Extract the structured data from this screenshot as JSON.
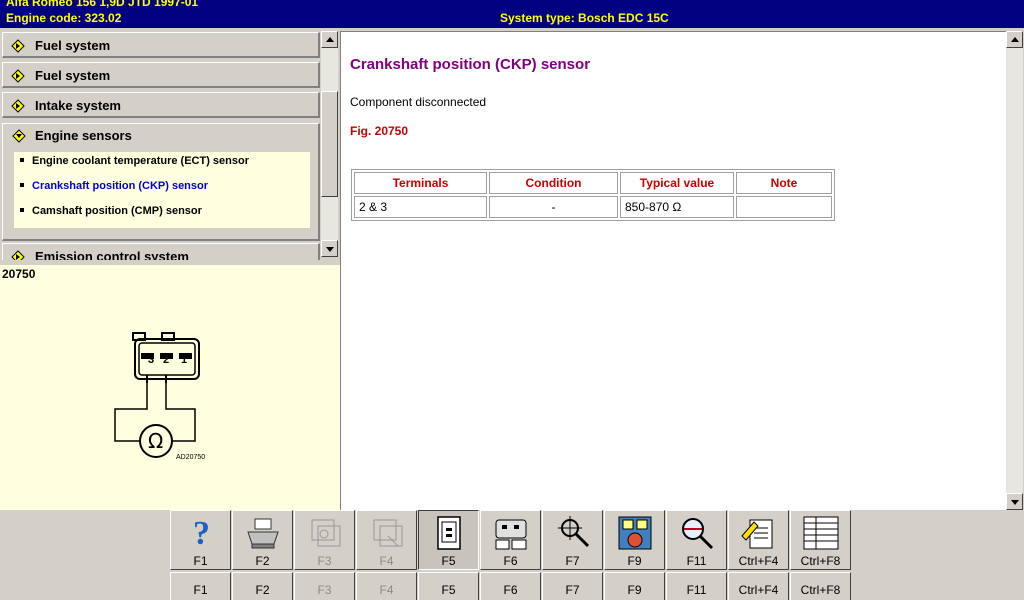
{
  "header": {
    "vehicle": "Alfa Romeo   156   1,9D JTD 1997-01",
    "engine_code": "Engine code: 323.02",
    "system_type": "System type: Bosch EDC 15C"
  },
  "nav": {
    "categories": [
      {
        "label": "Fuel system"
      },
      {
        "label": "Fuel system"
      },
      {
        "label": "Intake system"
      },
      {
        "label": "Engine sensors"
      },
      {
        "label": "Emission control system"
      }
    ],
    "sub_items": [
      {
        "label": "Engine coolant temperature (ECT) sensor"
      },
      {
        "label": "Crankshaft position (CKP) sensor"
      },
      {
        "label": "Camshaft position (CMP) sensor"
      }
    ]
  },
  "diagram": {
    "figure_number": "20750",
    "pins": [
      "3",
      "2",
      "1"
    ],
    "meter_symbol": "Ω",
    "ref_code": "AD20750"
  },
  "content": {
    "title": "Crankshaft position (CKP) sensor",
    "status": "Component disconnected",
    "figure_ref": "Fig. 20750",
    "table": {
      "headers": [
        "Terminals",
        "Condition",
        "Typical value",
        "Note"
      ],
      "rows": [
        [
          "2 & 3",
          "-",
          "850-870 Ω",
          ""
        ]
      ]
    }
  },
  "toolbar": {
    "keys": [
      {
        "label": "F1",
        "icon": "help-icon"
      },
      {
        "label": "F2",
        "icon": "printer-icon"
      },
      {
        "label": "F3",
        "icon": "component-icon"
      },
      {
        "label": "F4",
        "icon": "component-search-icon"
      },
      {
        "label": "F5",
        "icon": "connector-icon"
      },
      {
        "label": "F6",
        "icon": "ecu-pin-icon"
      },
      {
        "label": "F7",
        "icon": "probe-icon"
      },
      {
        "label": "F9",
        "icon": "pin-selector-icon"
      },
      {
        "label": "F11",
        "icon": "search-zoom-icon"
      },
      {
        "label": "Ctrl+F4",
        "icon": "notes-icon"
      },
      {
        "label": "Ctrl+F8",
        "icon": "list-icon"
      }
    ],
    "keys_row2": [
      "F1",
      "F2",
      "F3",
      "F4",
      "F5",
      "F6",
      "F7",
      "F9",
      "F11",
      "Ctrl+F4",
      "Ctrl+F8"
    ]
  },
  "colors": {
    "header_bg": "#000080",
    "header_text": "#ffff00",
    "title": "#800080",
    "accent_red": "#cc0000",
    "active_link": "#0000cc",
    "panel_bg": "#ffffe0"
  }
}
